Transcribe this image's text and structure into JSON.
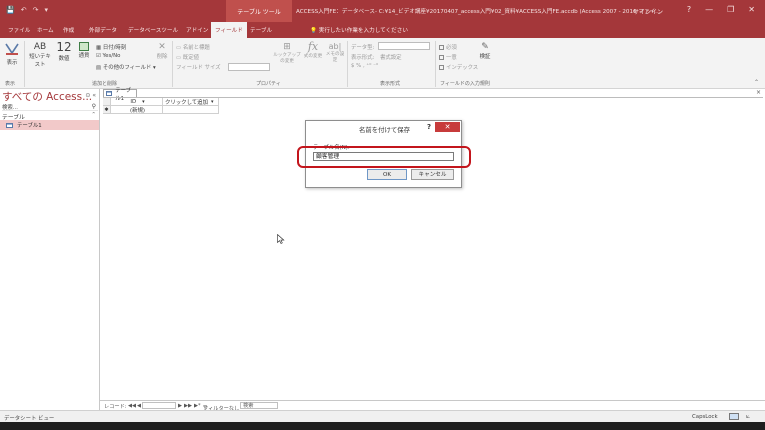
{
  "title_bar": {
    "qat": [
      "💾",
      "↶",
      "↷",
      "▾"
    ],
    "tool_title": "テーブル ツール",
    "document": "ACCESS入門FE：データベース- C:¥14_ビデオ講座¥20170407_access入門¥02_資料¥ACCESS入門FE.accdb (Access 2007 - 2016 ファイ...",
    "signin": "サインイン",
    "window_controls": [
      "?",
      "—",
      "❐",
      "✕"
    ]
  },
  "menu": {
    "tabs": [
      "ファイル",
      "ホーム",
      "作成",
      "外部データ",
      "データベースツール",
      "アドイン",
      "フィールド",
      "テーブル"
    ],
    "active": "フィールド",
    "tell_me": "実行したい作業を入力してください"
  },
  "ribbon": {
    "view_label": "表示",
    "view_group": "表示",
    "short_text": "短いテキスト",
    "number": "数値",
    "currency": "通貨",
    "date_time": "日付/時刻",
    "yes_no": "Yes/No",
    "more_fields": "その他のフィールド",
    "delete": "削除",
    "add_delete_group": "追加と削除",
    "name_caption": "名前と標題",
    "default_value": "既定値",
    "field_size": "フィールド サイズ",
    "lookup_change": "ルックアップの変更",
    "expression": "式の変更",
    "memo_settings": "メモの設定",
    "properties_group": "プロパティ",
    "data_type": "データ型:",
    "format": "表示形式:",
    "format_value": "書式設定",
    "format_group": "表示形式",
    "required": "必須",
    "unique": "一意",
    "indexed": "インデックス",
    "validation": "検証",
    "validation_group": "フィールドの入力規則"
  },
  "nav": {
    "header": "すべての Access...",
    "search_placeholder": "検索...",
    "group": "テーブル",
    "items": [
      "テーブル1"
    ]
  },
  "document": {
    "tab": "テーブル1",
    "columns": [
      "ID",
      "クリックして追加"
    ],
    "new_row": "(新規)"
  },
  "record_nav": {
    "label": "レコード:",
    "first": "◀◀",
    "prev": "◀",
    "next": "▶",
    "last": "▶▶",
    "new": "▶*",
    "filter": "フィルターなし",
    "search": "検索"
  },
  "status": {
    "view": "データシート ビュー",
    "caps": "CapsLock"
  },
  "dialog": {
    "title": "名前を付けて保存",
    "help": "?",
    "close": "✕",
    "label": "テーブル名(N):",
    "value": "顧客管理",
    "ok": "OK",
    "cancel": "キャンセル"
  },
  "colors": {
    "accent": "#a4373a",
    "highlight": "#c3151c"
  }
}
